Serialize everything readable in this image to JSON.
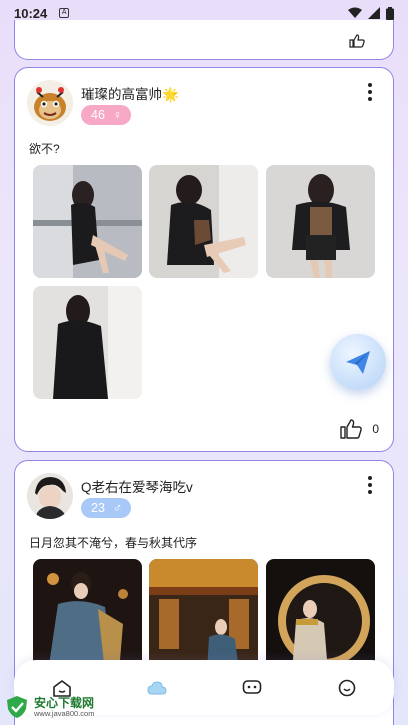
{
  "status": {
    "time": "10:24",
    "notif_glyph": "A",
    "icons": [
      "wifi-icon",
      "signal-icon",
      "battery-icon"
    ]
  },
  "posts": [
    {
      "username": "璀璨的高富帅🌟",
      "age": "46",
      "gender_symbol": "♀",
      "text": "欲不?",
      "likes": "0",
      "photos": 4
    },
    {
      "username": "Q老右在爱琴海吃v",
      "age": "23",
      "gender_symbol": "♂",
      "text": "日月忽其不淹兮，春与秋其代序",
      "photos": 3
    }
  ],
  "tabs": [
    "home-icon",
    "cloud-icon",
    "message-icon",
    "profile-icon"
  ],
  "watermark": {
    "title": "安心下载网",
    "url": "www.java800.com"
  },
  "colors": {
    "card_border": "#8e86e8",
    "badge_female": "#f7a8c6",
    "badge_male": "#a8c9f7"
  }
}
